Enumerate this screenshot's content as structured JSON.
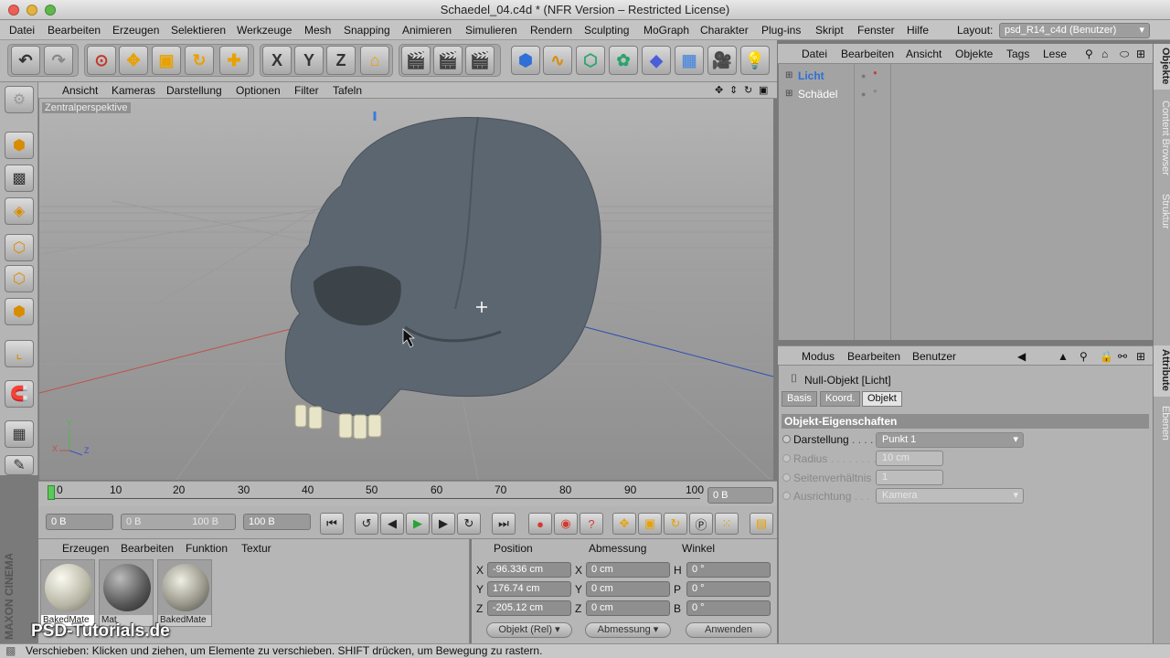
{
  "window": {
    "title": "Schaedel_04.c4d * (NFR Version – Restricted License)"
  },
  "menubar": {
    "items": [
      "Datei",
      "Bearbeiten",
      "Erzeugen",
      "Selektieren",
      "Werkzeuge",
      "Mesh",
      "Snapping",
      "Animieren",
      "Simulieren",
      "Rendern",
      "Sculpting",
      "MoGraph",
      "Charakter",
      "Plug-ins",
      "Skript",
      "Fenster",
      "Hilfe"
    ],
    "layout_label": "Layout:",
    "layout_value": "psd_R14_c4d (Benutzer)"
  },
  "toolbar": {
    "axis_x": "X",
    "axis_y": "Y",
    "axis_z": "Z"
  },
  "viewport": {
    "menu": [
      "Ansicht",
      "Kameras",
      "Darstellung",
      "Optionen",
      "Filter",
      "Tafeln"
    ],
    "label": "Zentralperspektive",
    "axis_y": "Y",
    "axis_x": "X",
    "axis_z": "Z"
  },
  "timeline": {
    "ticks": [
      "0",
      "10",
      "20",
      "30",
      "40",
      "50",
      "60",
      "70",
      "80",
      "90",
      "100"
    ],
    "current_frame": "0 B"
  },
  "transport": {
    "start": "0 B",
    "range_start": "0 B",
    "range_end": "100 B",
    "end": "100 B"
  },
  "materials": {
    "menu": [
      "Erzeugen",
      "Bearbeiten",
      "Funktion",
      "Textur"
    ],
    "items": [
      {
        "label": "BakedMate"
      },
      {
        "label": "Mat"
      },
      {
        "label": "BakedMate"
      }
    ]
  },
  "coords": {
    "headers": [
      "Position",
      "Abmessung",
      "Winkel"
    ],
    "rows": [
      {
        "axis": "X",
        "pos": "-96.336 cm",
        "dim_axis": "X",
        "dim": "0 cm",
        "ang_axis": "H",
        "ang": "0 °"
      },
      {
        "axis": "Y",
        "pos": "176.74 cm",
        "dim_axis": "Y",
        "dim": "0 cm",
        "ang_axis": "P",
        "ang": "0 °"
      },
      {
        "axis": "Z",
        "pos": "-205.12 cm",
        "dim_axis": "Z",
        "dim": "0 cm",
        "ang_axis": "B",
        "ang": "0 °"
      }
    ],
    "mode_select": "Objekt (Rel)",
    "size_select": "Abmessung",
    "apply_label": "Anwenden"
  },
  "objects": {
    "menu": [
      "Datei",
      "Bearbeiten",
      "Ansicht",
      "Objekte",
      "Tags",
      "Lese"
    ],
    "items": [
      {
        "name": "Licht"
      },
      {
        "name": "Schädel"
      }
    ]
  },
  "attributes": {
    "menu": [
      "Modus",
      "Bearbeiten",
      "Benutzer"
    ],
    "object_title": "Null-Objekt [Licht]",
    "tabs": [
      "Basis",
      "Koord.",
      "Objekt"
    ],
    "section": "Objekt-Eigenschaften",
    "fields": [
      {
        "label": "Darstellung",
        "dots": " . . . .",
        "value": "Punkt 1"
      },
      {
        "label": "Radius",
        "dots": " . . . . . . . .",
        "value": "10 cm"
      },
      {
        "label": "Seitenverhältnis",
        "dots": "",
        "value": "1"
      },
      {
        "label": "Ausrichtung",
        "dots": " . . .",
        "value": "Kamera"
      }
    ]
  },
  "sidetabs": [
    "Objekte",
    "Content Browser",
    "Struktur",
    "Attribute",
    "Ebenen"
  ],
  "status": "Verschieben: Klicken und ziehen, um Elemente zu verschieben. SHIFT drücken, um Bewegung zu rastern.",
  "watermark": "PSD-Tutorials.de",
  "brand": "MAXON CINEMA 4D",
  "colors": {
    "accent_blue": "#2f6fd6",
    "skull": "#5c6670",
    "teeth": "#e8e4c8"
  }
}
